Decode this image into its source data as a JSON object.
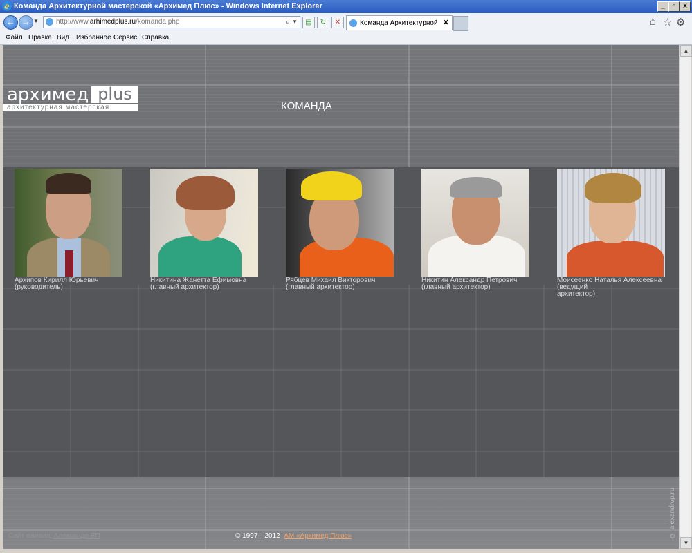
{
  "window": {
    "title": "Команда Архитектурной мастерской «Архимед Плюс» - Windows Internet Explorer",
    "min": "_",
    "max": "▫",
    "close": "x"
  },
  "nav": {
    "url_prefix": "http://www.",
    "url_domain": "arhimedplus.ru",
    "url_path": "/komanda.php",
    "tab_title": "Команда Архитектурной м...",
    "tab_close": "✕"
  },
  "menu": [
    "Файл",
    "Правка",
    "Вид",
    "Избранное",
    "Сервис",
    "Справка"
  ],
  "logo": {
    "word": "архимед",
    "plus": "plus",
    "subtitle": "архитектурная мастерская"
  },
  "page": {
    "title": "КОМАНДА"
  },
  "team": [
    {
      "name": "Архипов Кирилл Юрьевич",
      "role": "(руководитель)"
    },
    {
      "name": "Никитина Жанетта Ефимовна",
      "role": "(главный архитектор)"
    },
    {
      "name": "Рябцев Михаил Викторович",
      "role": "(главный архитектор)"
    },
    {
      "name": "Никитин Александр Петрович",
      "role": "(главный архитектор)"
    },
    {
      "name": "Моисеенко Наталья Алексеевна (ведущий",
      "role": "архитектор)"
    }
  ],
  "footer": {
    "credit_label": "Сайт оживил:",
    "credit_link": "Александр ВП",
    "copyright": "© 1997—2012",
    "company_link": "АМ «Архимед Плюс»",
    "watermark": "© alexandrvp.ru"
  },
  "colors": {
    "page_bg": "#7d7e81",
    "body_bg": "#55565a",
    "link_accent": "#f2a36a"
  }
}
